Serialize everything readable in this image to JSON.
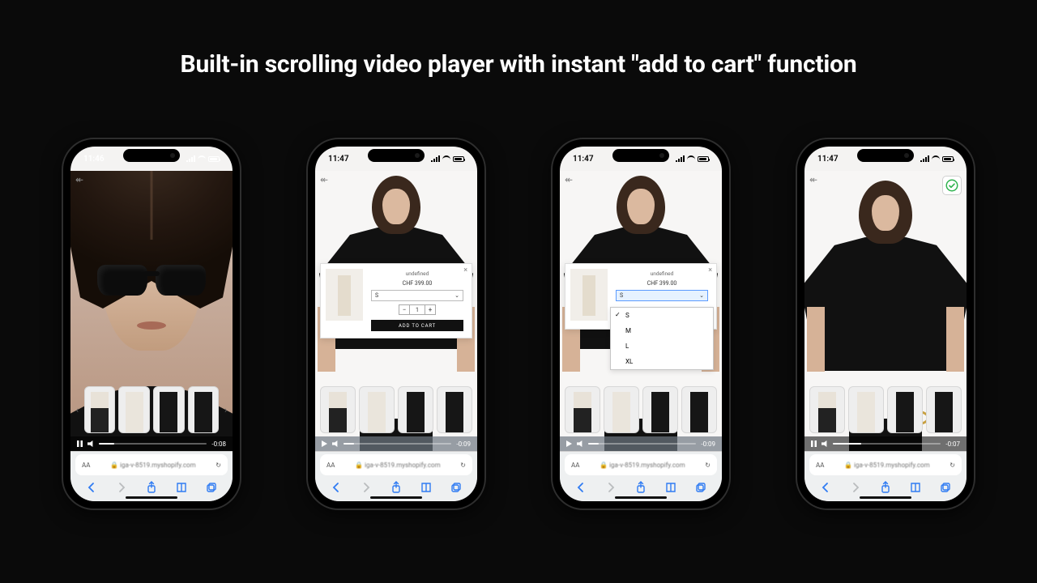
{
  "headline": "Built-in scrolling video player with instant \"add to cart\" function",
  "phones": [
    {
      "time": "11:46",
      "time_icon": "🔇",
      "remain": "-0:08",
      "playstate": "pause"
    },
    {
      "time": "11:47",
      "time_icon": "🔇",
      "remain": "-0:09",
      "playstate": "play"
    },
    {
      "time": "11:47",
      "time_icon": "🔇",
      "remain": "-0:09",
      "playstate": "play"
    },
    {
      "time": "11:47",
      "time_icon": "🔇",
      "remain": "-0:07",
      "playstate": "pause"
    }
  ],
  "safari": {
    "aa": "AA",
    "lock": "🔒",
    "url": "iga-v-8519.myshopify.com",
    "reload": "↻"
  },
  "modal": {
    "title": "undefined",
    "price": "CHF 399.00",
    "size": "S",
    "qty": "1",
    "minus": "−",
    "plus": "+",
    "add": "ADD TO CART",
    "chevron": "⌄",
    "close": "×"
  },
  "sizes": [
    "S",
    "M",
    "L",
    "XL"
  ]
}
